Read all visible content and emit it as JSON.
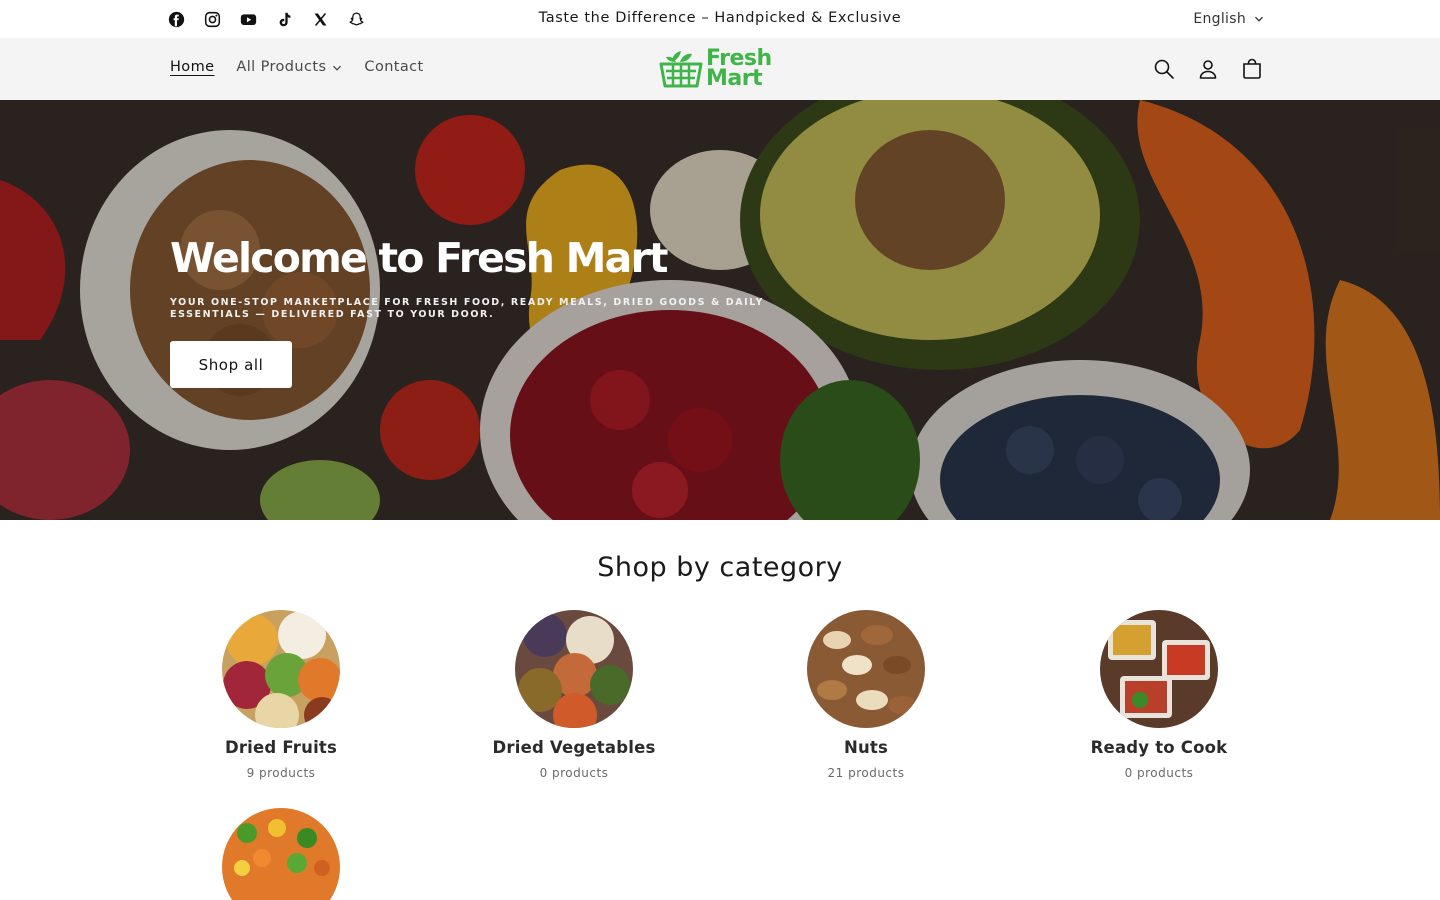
{
  "announcement": {
    "text": "Taste the Difference – Handpicked & Exclusive",
    "language": "English",
    "social_icons": [
      "facebook-icon",
      "instagram-icon",
      "youtube-icon",
      "tiktok-icon",
      "x-icon",
      "snapchat-icon"
    ]
  },
  "header": {
    "nav": [
      {
        "label": "Home",
        "active": true
      },
      {
        "label": "All Products",
        "dropdown": true
      },
      {
        "label": "Contact"
      }
    ],
    "logo": {
      "line1": "Fresh",
      "line2": "Mart",
      "color": "#3fb549"
    },
    "icons": [
      "search-icon",
      "account-icon",
      "cart-icon"
    ]
  },
  "hero": {
    "title": "Welcome to Fresh Mart",
    "subtitle": "Your one-stop marketplace for fresh food, ready meals, dried goods & daily essentials — delivered fast to your door.",
    "button": "Shop all"
  },
  "categories": {
    "title": "Shop by category",
    "items": [
      {
        "name": "Dried Fruits",
        "count": "9 products"
      },
      {
        "name": "Dried Vegetables",
        "count": "0 products"
      },
      {
        "name": "Nuts",
        "count": "21 products"
      },
      {
        "name": "Ready to Cook",
        "count": "0 products"
      },
      {
        "name": "",
        "count": ""
      }
    ]
  }
}
